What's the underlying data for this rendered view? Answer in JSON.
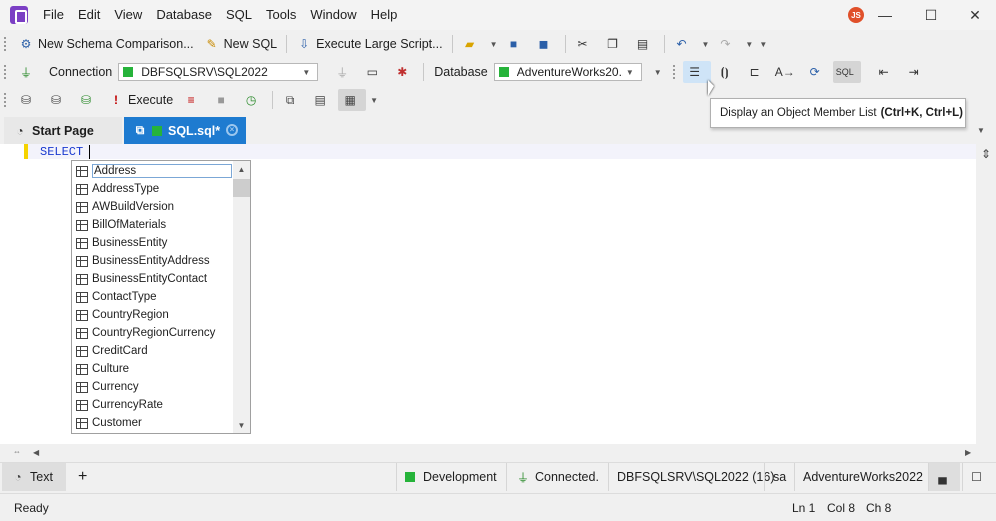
{
  "menu": [
    "File",
    "Edit",
    "View",
    "Database",
    "SQL",
    "Tools",
    "Window",
    "Help"
  ],
  "user_initials": "JS",
  "window_controls": {
    "minimize": "—",
    "maximize": "☐",
    "close": "✕"
  },
  "toolbar1": {
    "new_schema_comparison": "New Schema Comparison...",
    "new_sql": "New SQL",
    "execute_large_script": "Execute Large Script..."
  },
  "toolbar2": {
    "connection_label": "Connection",
    "connection_value": "DBFSQLSRV\\SQL2022",
    "database_label": "Database",
    "database_value": "AdventureWorks20..."
  },
  "toolbar3": {
    "execute_label": "Execute"
  },
  "tooltip": {
    "text": "Display an Object Member List",
    "shortcut": "(Ctrl+K, Ctrl+L)"
  },
  "tabs": {
    "start_page": "Start Page",
    "sql_tab": "SQL.sql*"
  },
  "editor": {
    "keyword": "SELECT"
  },
  "member_list": [
    "Address",
    "AddressType",
    "AWBuildVersion",
    "BillOfMaterials",
    "BusinessEntity",
    "BusinessEntityAddress",
    "BusinessEntityContact",
    "ContactType",
    "CountryRegion",
    "CountryRegionCurrency",
    "CreditCard",
    "Culture",
    "Currency",
    "CurrencyRate",
    "Customer"
  ],
  "bottombar": {
    "text_tab": "Text",
    "add": "+",
    "environment": "Development",
    "connection_status": "Connected.",
    "server": "DBFSQLSRV\\SQL2022 (16)",
    "user": "sa",
    "database": "AdventureWorks2022"
  },
  "statusbar": {
    "state": "Ready",
    "line": "Ln 1",
    "col": "Col 8",
    "ch": "Ch 8"
  },
  "colors": {
    "accent": "#1e7bd0",
    "status_green": "#26b33a",
    "keyword": "#1a3ad0"
  }
}
